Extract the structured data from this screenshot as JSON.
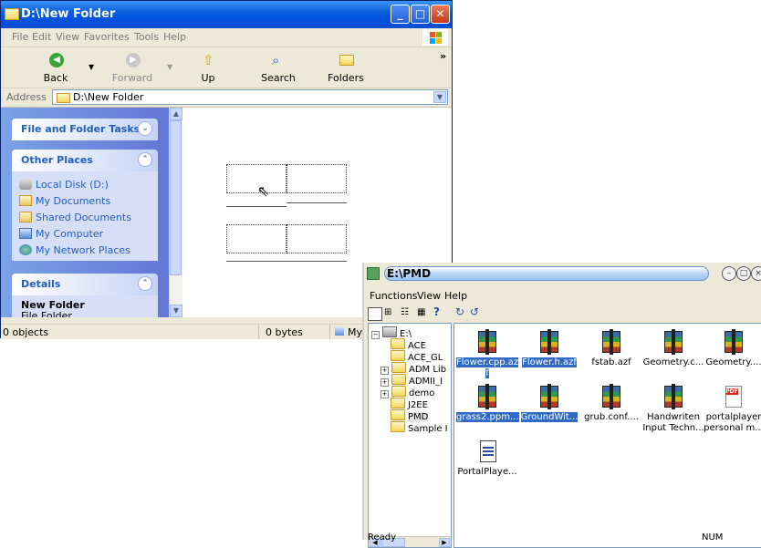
{
  "win1": {
    "title": "D:\\New Folder",
    "menu": [
      "File",
      "Edit",
      "View",
      "Favorites",
      "Tools",
      "Help"
    ],
    "toolbar": {
      "back": "Back",
      "forward": "Forward",
      "up": "Up",
      "search": "Search",
      "folders": "Folders",
      "more": "»"
    },
    "address_label": "Address",
    "address_value": "D:\\New Folder",
    "panels": {
      "tasks_title": "File and Folder Tasks",
      "other_title": "Other Places",
      "other_links": [
        "Local Disk (D:)",
        "My Documents",
        "Shared Documents",
        "My Computer",
        "My Network Places"
      ],
      "details_title": "Details",
      "details_name": "New Folder",
      "details_type": "File Folder"
    },
    "status": {
      "objects": "0 objects",
      "size": "0 bytes",
      "location": "My C"
    }
  },
  "win2": {
    "title": "E:\\PMD",
    "menu": [
      "Functions",
      "View",
      "Help"
    ],
    "tree": {
      "root": "E:\\",
      "items": [
        "ACE",
        "ACE_GL",
        "ADM Lib",
        "ADMII_I",
        "demo",
        "J2EE",
        "PMD",
        "Sample I"
      ]
    },
    "files": [
      {
        "name": "Flower.cpp.azf",
        "label": "Flower.cpp.az f",
        "selected": true,
        "icon": "archive-icon"
      },
      {
        "name": "Flower.h.azf",
        "label": "Flower.h.azf",
        "selected": true,
        "icon": "archive-icon"
      },
      {
        "name": "fstab.azf",
        "label": "fstab.azf",
        "selected": false,
        "icon": "archive-icon"
      },
      {
        "name": "Geometry.c...",
        "label": "Geometry.c...",
        "selected": false,
        "icon": "archive-icon"
      },
      {
        "name": "Geometry....",
        "label": "Geometry....",
        "selected": false,
        "icon": "archive-icon"
      },
      {
        "name": "grass2.ppm...",
        "label": "grass2.ppm...",
        "selected": true,
        "icon": "archive-icon"
      },
      {
        "name": "GroundWit...",
        "label": "GroundWit...",
        "selected": true,
        "icon": "archive-icon"
      },
      {
        "name": "grub.conf....",
        "label": "grub.conf....",
        "selected": false,
        "icon": "archive-icon"
      },
      {
        "name": "Handwriten Input Techn...",
        "label": "Handwriten Input Techn...",
        "selected": false,
        "icon": "archive-icon"
      },
      {
        "name": "portalplayer personal m...",
        "label": "portalplayer personal m...",
        "selected": false,
        "icon": "pdf-icon"
      },
      {
        "name": "PortalPlaye...",
        "label": "PortalPlaye...",
        "selected": false,
        "icon": "document-icon"
      }
    ],
    "status": {
      "ready": "Ready",
      "num": "NUM"
    }
  },
  "colors": {
    "xp_blue": "#0054e3",
    "task_link": "#215dc6",
    "selection": "#316ac5"
  }
}
